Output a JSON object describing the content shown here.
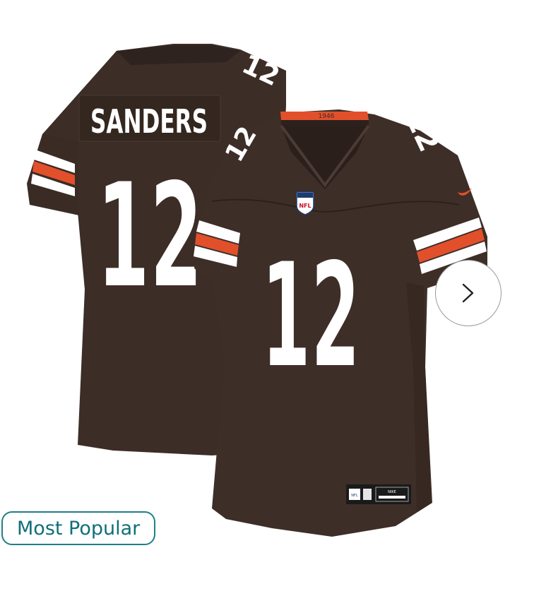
{
  "product": {
    "back_name": "SANDERS",
    "number": "12",
    "collar_year": "1946",
    "shield_text": "NFL",
    "tag_left": "NFL",
    "tag_brand": "NIKE",
    "colors": {
      "brown": "#3e2e28",
      "brown_dark": "#2c211d",
      "orange": "#e1502b",
      "white": "#ffffff"
    }
  },
  "carousel": {
    "next_icon": "chevron-right-icon"
  },
  "badge": {
    "label": "Most Popular",
    "color": "#1e7f86"
  }
}
